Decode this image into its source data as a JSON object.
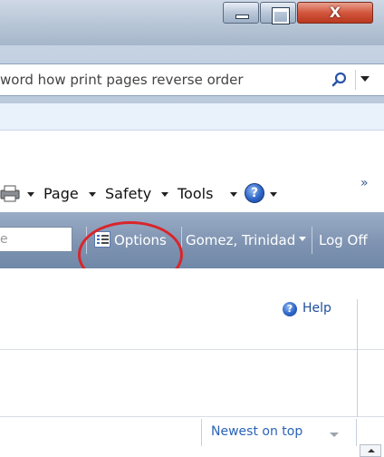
{
  "window": {
    "close_glyph": "X"
  },
  "search": {
    "query": "word how print pages reverse order"
  },
  "commandbar": {
    "page_label": "Page",
    "safety_label": "Safety",
    "tools_label": "Tools",
    "overflow": "»"
  },
  "appnav": {
    "search_placeholder": "e",
    "options_label": "Options",
    "user_label": "Gomez, Trinidad",
    "logoff_label": "Log Off"
  },
  "help": {
    "label": "Help"
  },
  "list": {
    "sort_label": "Newest on top"
  },
  "colors": {
    "accent_annotation": "#d9252b",
    "nav_bar": "#7d92b0",
    "link": "#1f4e9b"
  }
}
